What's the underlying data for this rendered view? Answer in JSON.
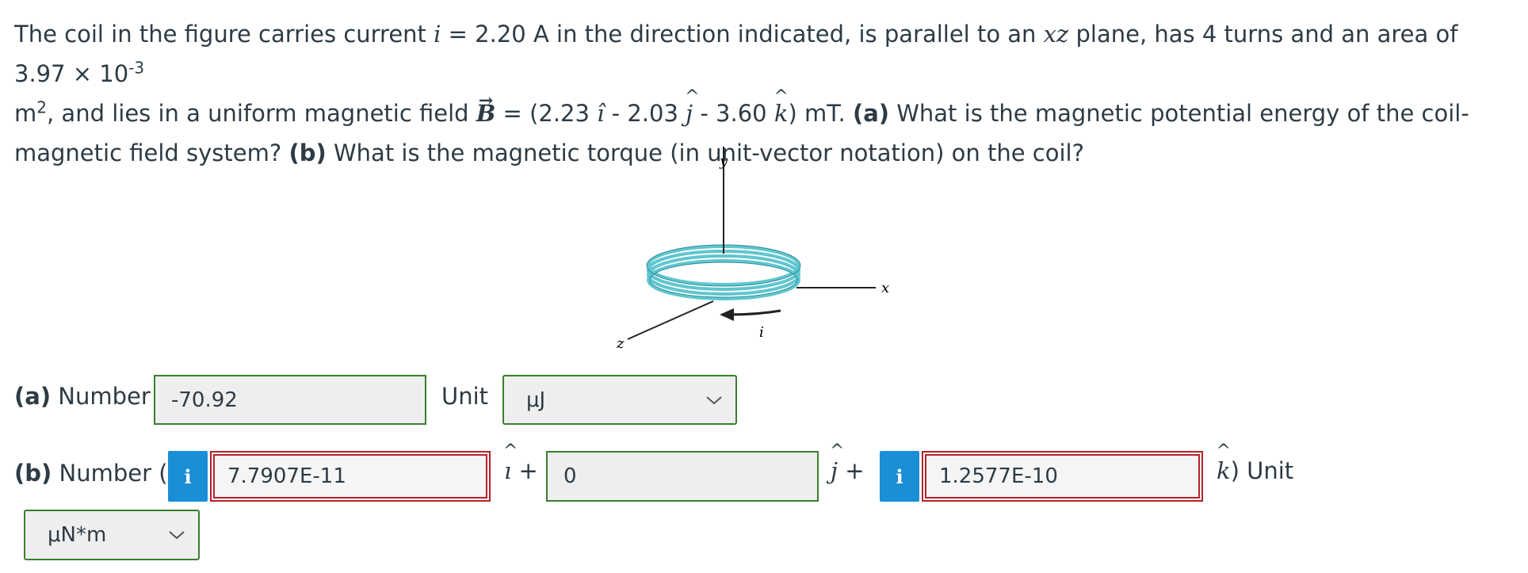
{
  "question": {
    "p1": "The coil in the figure carries current ",
    "i_var": "i",
    "p2": " = 2.20 A in the direction indicated, is parallel to an ",
    "xz": "xz",
    "p3": " plane, has 4 turns and an area of 3.97 × 10",
    "exp1": "-3",
    "line2_m": "m",
    "exp2": "2",
    "p4": ", and lies in a uniform magnetic field ",
    "b_symbol": "B",
    "p5": " = (2.23 ",
    "i_hat": "î",
    "p6": " - 2.03 ",
    "j_hat": "j",
    "p7": " - 3.60 ",
    "k_hat": "k",
    "p8": ") mT. ",
    "part_a_label": "(a)",
    "part_a_text": " What is the magnetic potential energy of the coil-magnetic field system? ",
    "part_b_label": "(b)",
    "part_b_text": " What is the magnetic torque (in unit-vector notation) on the coil?"
  },
  "figure": {
    "y_label": "y",
    "x_label": "x",
    "z_label": "z",
    "i_label": "i"
  },
  "part_a": {
    "label_bold": "(a)",
    "label_text": " Number",
    "value": "-70.92",
    "unit_label": "Unit",
    "unit_value": "μJ"
  },
  "part_b": {
    "label_bold": "(b)",
    "label_text": " Number (",
    "info_icon": "i",
    "i_value": "7.7907E-11",
    "i_suffix": "+",
    "j_value": "0",
    "j_suffix": "+",
    "k_value": "1.2577E-10",
    "k_suffix": ") Unit",
    "unit_value": "μN*m"
  },
  "colors": {
    "border_ok": "#3a7d2e",
    "border_err": "#b3232a",
    "info_blue": "#1a8ed6",
    "coil": "#5fc6cf"
  }
}
